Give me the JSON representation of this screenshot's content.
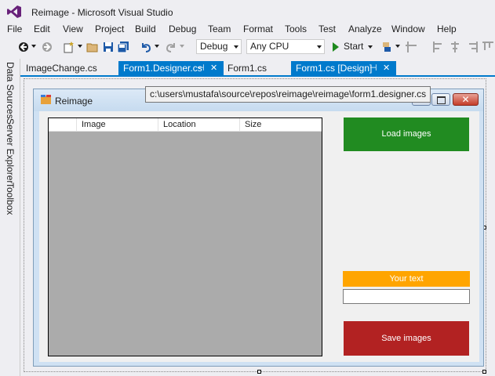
{
  "window": {
    "title": "Reimage - Microsoft Visual Studio"
  },
  "menu": {
    "items": [
      "File",
      "Edit",
      "View",
      "Project",
      "Build",
      "Debug",
      "Team",
      "Format",
      "Tools",
      "Test",
      "Analyze",
      "Window",
      "Help"
    ]
  },
  "toolbar": {
    "configuration": "Debug",
    "platform": "Any CPU",
    "start_label": "Start"
  },
  "left_rail": {
    "tabs": [
      "Data Sources",
      "Server Explorer",
      "Toolbox"
    ]
  },
  "tabs": [
    {
      "label": "ImageChange.cs",
      "active": false
    },
    {
      "label": "Form1.Designer.cs",
      "active": true
    },
    {
      "label": "Form1.cs",
      "active": false
    },
    {
      "label": "Form1.cs [Design]",
      "active": true
    }
  ],
  "tooltip": "c:\\users\\mustafa\\source\\repos\\reimage\\reimage\\form1.designer.cs",
  "form": {
    "title": "Reimage",
    "grid": {
      "columns": [
        "",
        "Image",
        "Location",
        "Size"
      ]
    },
    "load_button": "Load images",
    "your_text_label": "Your text",
    "your_text_value": "",
    "save_button": "Save images"
  },
  "colors": {
    "accent": "#007acc",
    "load_button": "#218b21",
    "your_text_label": "#ffa500",
    "save_button": "#b22222",
    "grid_background": "#ababab"
  }
}
